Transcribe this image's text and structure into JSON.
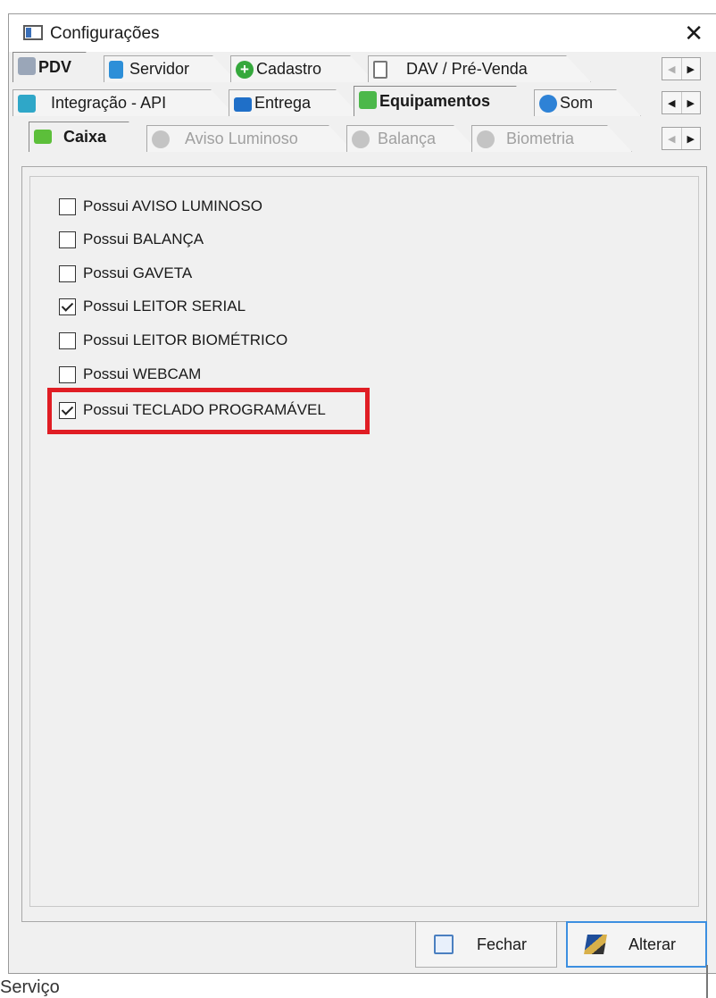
{
  "window": {
    "title": "Configurações",
    "close_glyph": "✕"
  },
  "tabs_level1": [
    {
      "label": "PDV",
      "icon": "pdv-icon",
      "active": true
    },
    {
      "label": "Servidor",
      "icon": "server-icon"
    },
    {
      "label": "Cadastro",
      "icon": "plus-icon"
    },
    {
      "label": "DAV / Pré-Venda",
      "icon": "document-icon"
    }
  ],
  "tabs_level2": [
    {
      "label": "Integração - API",
      "icon": "sync-icon"
    },
    {
      "label": "Entrega",
      "icon": "truck-icon"
    },
    {
      "label": "Equipamentos",
      "icon": "equipment-icon",
      "active": true
    },
    {
      "label": "Som",
      "icon": "sound-icon"
    }
  ],
  "tabs_level3": [
    {
      "label": "Caixa",
      "icon": "cash-register-icon",
      "active": true
    },
    {
      "label": "Aviso Luminoso",
      "icon": "gear-icon",
      "disabled": true
    },
    {
      "label": "Balança",
      "icon": "gear-icon",
      "disabled": true
    },
    {
      "label": "Biometria",
      "icon": "gear-icon",
      "disabled": true
    }
  ],
  "scroll": {
    "left": "◀",
    "right": "▶"
  },
  "options": [
    {
      "label": "Possui AVISO LUMINOSO",
      "checked": false
    },
    {
      "label": "Possui BALANÇA",
      "checked": false
    },
    {
      "label": "Possui GAVETA",
      "checked": false
    },
    {
      "label": "Possui LEITOR SERIAL",
      "checked": true
    },
    {
      "label": "Possui LEITOR BIOMÉTRICO",
      "checked": false
    },
    {
      "label": "Possui WEBCAM",
      "checked": false
    },
    {
      "label": "Possui TECLADO PROGRAMÁVEL",
      "checked": true
    }
  ],
  "highlight_color": "#e01d24",
  "buttons": {
    "close_label": "Fechar",
    "edit_label": "Alterar"
  },
  "background_text": "Serviço"
}
